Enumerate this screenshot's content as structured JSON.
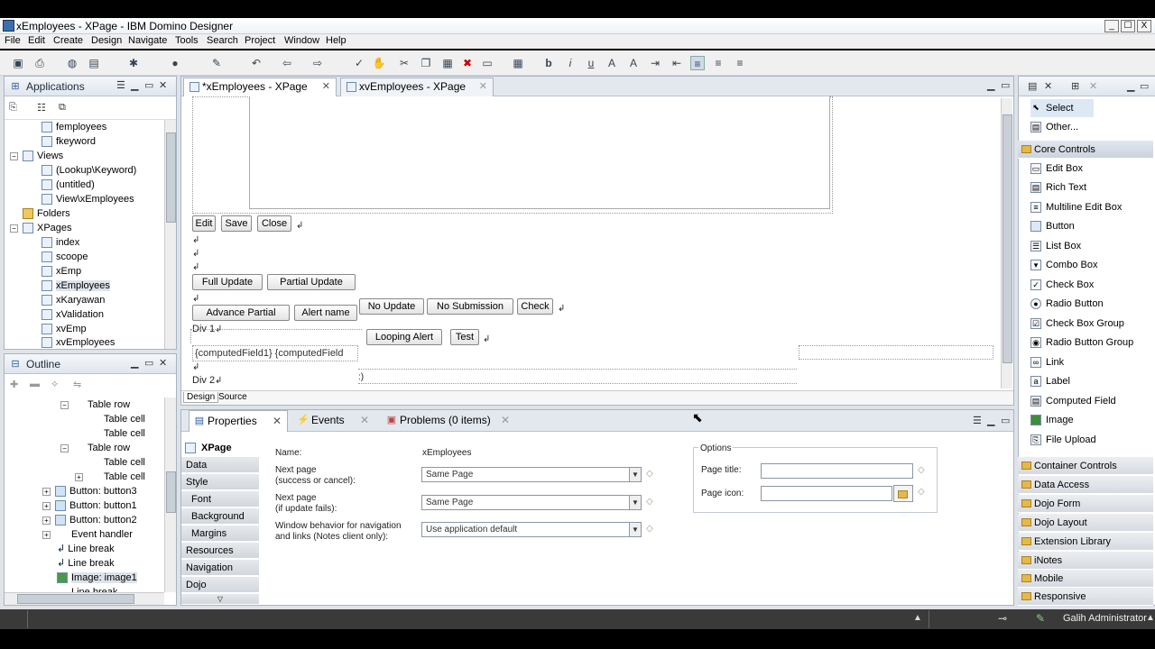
{
  "window": {
    "title": "xEmployees - XPage - IBM Domino Designer",
    "controls": [
      "_",
      "☐",
      "X"
    ]
  },
  "menu": [
    "File",
    "Edit",
    "Create",
    "Design",
    "Navigate",
    "Tools",
    "Search",
    "Project",
    "Window",
    "Help"
  ],
  "applications": {
    "title": "Applications",
    "items": [
      "femployees",
      "fkeyword",
      "Views",
      "(Lookup\\Keyword)",
      "(untitled)",
      "View\\xEmployees",
      "Folders",
      "XPages",
      "index",
      "scoope",
      "xEmp",
      "xEmployees",
      "xKaryawan",
      "xValidation",
      "xvEmp",
      "xvEmployees"
    ]
  },
  "outline": {
    "title": "Outline",
    "items": [
      "Table row",
      "Table cell",
      "Table cell",
      "Table row",
      "Table cell",
      "Table cell",
      "Button: button3",
      "Button: button1",
      "Button: button2",
      "Event handler",
      "Line break",
      "Line break",
      "Image: image1",
      "Line break"
    ]
  },
  "editor": {
    "tabs": [
      "*xEmployees - XPage",
      "xvEmployees - XPage"
    ],
    "buttons1": [
      "Edit",
      "Save",
      "Close"
    ],
    "buttons2": [
      "Full Update",
      "Partial Update"
    ],
    "buttons3": [
      "No Update",
      "No Submission",
      "Check"
    ],
    "buttons4": [
      "Advance Partial",
      "Alert name"
    ],
    "buttons5": [
      "Looping Alert",
      "Test"
    ],
    "div1": "Div 1",
    "computed": "{computedField1} {computedField",
    "div2": "Div 2",
    "small_mark": ":)",
    "bottom_tabs": [
      "Design",
      "Source"
    ]
  },
  "properties": {
    "tabs": [
      "Properties",
      "Events",
      "Problems (0 items)"
    ],
    "nav": [
      "XPage",
      "Data",
      "Style",
      "Font",
      "Background",
      "Margins",
      "Resources",
      "Navigation",
      "Dojo"
    ],
    "name_label": "Name:",
    "name_value": "xEmployees",
    "next_page_label_1": "Next page",
    "next_page_label_2": "(success or cancel):",
    "next_page_value": "Same Page",
    "next_fail_label_1": "Next page",
    "next_fail_label_2": "(if update fails):",
    "next_fail_value": "Same Page",
    "window_label_1": "Window behavior for navigation",
    "window_label_2": "and links (Notes client only):",
    "window_value": "Use application default",
    "options_title": "Options",
    "page_title_label": "Page title:",
    "page_icon_label": "Page icon:"
  },
  "palette": {
    "top": [
      "Select",
      "Other..."
    ],
    "core_title": "Core Controls",
    "core": [
      "Edit Box",
      "Rich Text",
      "Multiline Edit Box",
      "Button",
      "List Box",
      "Combo Box",
      "Check Box",
      "Radio Button",
      "Check Box Group",
      "Radio Button Group",
      "Link",
      "Label",
      "Computed Field",
      "Image",
      "File Upload"
    ],
    "drawers": [
      "Container Controls",
      "Data Access",
      "Dojo Form",
      "Dojo Layout",
      "Extension Library",
      "iNotes",
      "Mobile",
      "Responsive"
    ]
  },
  "status": {
    "user": "Galih Administrator"
  }
}
